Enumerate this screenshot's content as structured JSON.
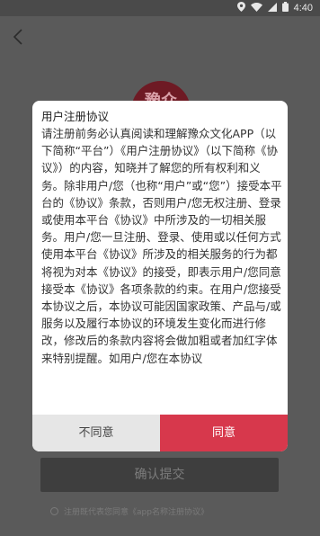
{
  "status_bar": {
    "time": "4:40",
    "icons": [
      "location-icon",
      "wifi-icon",
      "signal-icon",
      "battery-icon"
    ]
  },
  "background": {
    "logo_text": "豫众",
    "submit_label": "确认提交",
    "agreement_text": "注册既代表您同意《app名称注册协议》"
  },
  "dialog": {
    "title": "用户注册协议",
    "body": "请注册前务必认真阅读和理解豫众文化APP（以下简称“平台”）《用户注册协议》（以下简称《协议》）的内容，知晓并了解您的所有权利和义务。除非用户/您（也称“用户”或“您”）接受本平台的《协议》条款，否则用户/您无权注册、登录或使用本平台《协议》中所涉及的一切相关服务。用户/您一旦注册、登录、使用或以任何方式使用本平台《协议》所涉及的相关服务的行为都将视为对本《协议》的接受，即表示用户/您同意接受本《协议》各项条款的约束。在用户/您接受本协议之后，本协议可能因国家政策、产品与/或服务以及履行本协议的环境发生变化而进行修改，修改后的条款内容将会做加粗或者加红字体来特别提醒。如用户/您在本协议",
    "disagree_label": "不同意",
    "agree_label": "同意"
  },
  "colors": {
    "accent": "#d7384c",
    "overlay": "#5a5a5a",
    "disagree_bg": "#e6e6e6"
  }
}
